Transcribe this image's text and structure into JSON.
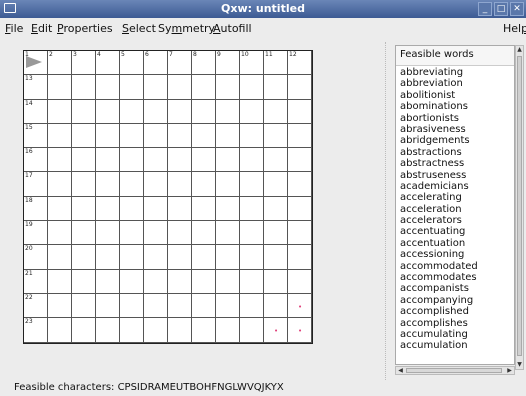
{
  "window": {
    "title": "Qxw: untitled"
  },
  "menu": {
    "items": [
      {
        "label": "File",
        "underline_index": 0
      },
      {
        "label": "Edit",
        "underline_index": 0
      },
      {
        "label": "Properties",
        "underline_index": 0
      },
      {
        "label": "Select",
        "underline_index": 0
      },
      {
        "label": "Symmetry",
        "underline_index": 2
      },
      {
        "label": "Autofill",
        "underline_index": 0
      }
    ],
    "help": {
      "label": "Help",
      "underline_index": 3
    }
  },
  "grid": {
    "rows": 12,
    "cols": 12,
    "top_numbers": [
      "1",
      "2",
      "3",
      "4",
      "5",
      "6",
      "7",
      "8",
      "9",
      "10",
      "11",
      "12"
    ],
    "left_numbers": [
      "13",
      "14",
      "15",
      "16",
      "17",
      "18",
      "19",
      "20",
      "21",
      "22",
      "23"
    ],
    "marks": [
      {
        "row": 10,
        "col": 11,
        "symbol": "•"
      },
      {
        "row": 11,
        "col": 10,
        "symbol": "•"
      },
      {
        "row": 11,
        "col": 11,
        "symbol": "•"
      }
    ]
  },
  "wordpanel": {
    "header": "Feasible words",
    "words": [
      "abbreviating",
      "abbreviation",
      "abolitionist",
      "abominations",
      "abortionists",
      "abrasiveness",
      "abridgements",
      "abstractions",
      "abstractness",
      "abstruseness",
      "academicians",
      "accelerating",
      "acceleration",
      "accelerators",
      "accentuating",
      "accentuation",
      "accessioning",
      "accommodated",
      "accommodates",
      "accompanists",
      "accompanying",
      "accomplished",
      "accomplishes",
      "accumulating",
      "accumulation"
    ]
  },
  "status": {
    "text": "Feasible characters: CPSIDRAMEUTBOHFNGLWVQJKYX"
  },
  "colors": {
    "titlebar": "#4a6aa5",
    "mark": "#e0407a"
  }
}
